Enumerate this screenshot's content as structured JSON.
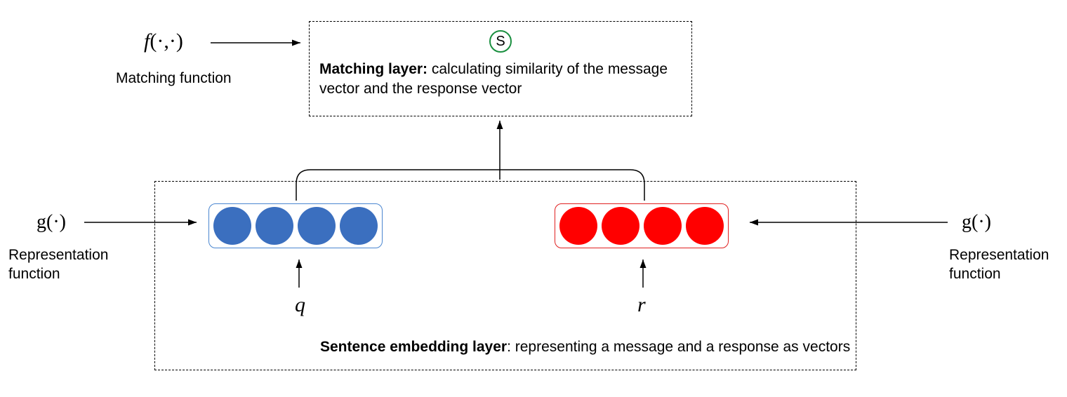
{
  "top": {
    "f_symbol": "f",
    "f_args": "(·,·)",
    "label": "Matching function"
  },
  "matching_layer": {
    "s": "S",
    "title": "Matching layer:",
    "desc": " calculating similarity of the message vector and the response vector"
  },
  "embedding_layer": {
    "title": "Sentence embedding layer",
    "desc": ": representing a message and a response as vectors",
    "q": "q",
    "r": "r"
  },
  "g": {
    "symbol": "g",
    "args": "(·)",
    "label": "Representation function"
  }
}
